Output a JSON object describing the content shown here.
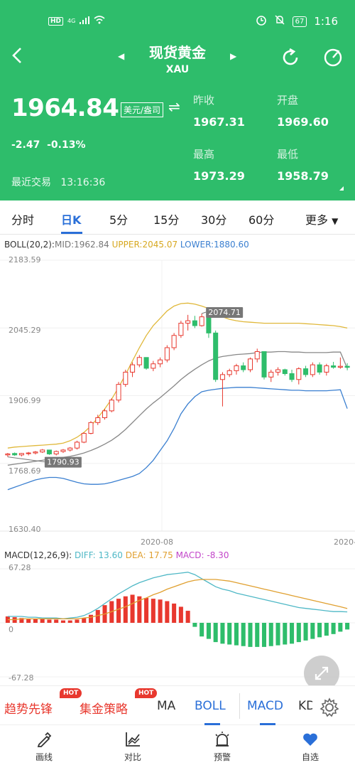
{
  "status_bar": {
    "network": "HD",
    "signal": "4G",
    "battery": "67",
    "time": "1:16"
  },
  "header": {
    "title": "现货黄金",
    "code": "XAU"
  },
  "quote": {
    "price": "1964.84",
    "unit": "美元/盎司",
    "change": "-2.47",
    "change_pct": "-0.13%",
    "last_trade_label": "最近交易",
    "last_trade_time": "13:16:36",
    "prev_close_label": "昨收",
    "prev_close": "1967.31",
    "open_label": "开盘",
    "open": "1969.60",
    "high_label": "最高",
    "high": "1973.29",
    "low_label": "最低",
    "low": "1958.79"
  },
  "period_tabs": [
    "分时",
    "日K",
    "5分",
    "15分",
    "30分",
    "60分",
    "更多"
  ],
  "active_period": "日K",
  "boll": {
    "label": "BOLL(20,2):",
    "mid": "MID:1962.84",
    "upper": "UPPER:2045.07",
    "lower": "LOWER:1880.60",
    "y_ticks": [
      "2183.59",
      "2045.29",
      "1906.99",
      "1768.69",
      "1630.40"
    ],
    "x_ticks": [
      "2020-08",
      "2020-"
    ],
    "max_marker": "2074.71",
    "min_marker": "1790.93"
  },
  "macd": {
    "label": "MACD(12,26,9):",
    "diff": "DIFF: 13.60",
    "dea": "DEA: 17.75",
    "macd": "MACD: -8.30",
    "y_ticks": [
      "67.28",
      "0",
      "-67.28"
    ]
  },
  "indicator_tabs": {
    "trend": "趋势先锋",
    "strategy": "集金策略",
    "hot": "HOT",
    "ma": "MA",
    "boll": "BOLL",
    "macd": "MACD",
    "kd": "KD"
  },
  "bottom_nav": [
    "画线",
    "对比",
    "预警",
    "自选"
  ],
  "colors": {
    "green": "#2ebd6b",
    "up": "#e8382e",
    "down": "#2ebd6b",
    "accent": "#2a6fd8",
    "mid": "#888888",
    "upper": "#e0b83a",
    "lower": "#3a7fd0",
    "diff": "#4fb8c6",
    "dea": "#e0a030",
    "macd": "#c244c9"
  },
  "chart_data": [
    {
      "type": "candlestick",
      "title": "BOLL(20,2)",
      "ylim": [
        1630.4,
        2183.59
      ],
      "y_ticks": [
        2183.59,
        2045.29,
        1906.99,
        1768.69,
        1630.4
      ],
      "series": [
        {
          "name": "K",
          "ohlc": [
            [
              1786,
              1790,
              1782,
              1788
            ],
            [
              1789,
              1791,
              1784,
              1786
            ],
            [
              1786,
              1790,
              1783,
              1789
            ],
            [
              1789,
              1792,
              1785,
              1790
            ],
            [
              1790,
              1794,
              1787,
              1792
            ],
            [
              1792,
              1798,
              1790,
              1796
            ],
            [
              1796,
              1794,
              1786,
              1788
            ],
            [
              1788,
              1795,
              1785,
              1793
            ],
            [
              1793,
              1798,
              1790,
              1796
            ],
            [
              1796,
              1802,
              1793,
              1800
            ],
            [
              1800,
              1815,
              1797,
              1812
            ],
            [
              1812,
              1832,
              1810,
              1830
            ],
            [
              1830,
              1855,
              1828,
              1852
            ],
            [
              1852,
              1868,
              1847,
              1862
            ],
            [
              1862,
              1880,
              1858,
              1876
            ],
            [
              1876,
              1902,
              1873,
              1898
            ],
            [
              1898,
              1935,
              1893,
              1930
            ],
            [
              1930,
              1960,
              1925,
              1955
            ],
            [
              1955,
              1975,
              1945,
              1970
            ],
            [
              1970,
              1990,
              1965,
              1985
            ],
            [
              1985,
              1980,
              1960,
              1963
            ],
            [
              1963,
              1978,
              1957,
              1972
            ],
            [
              1972,
              1985,
              1965,
              1980
            ],
            [
              1980,
              2010,
              1975,
              2005
            ],
            [
              2005,
              2035,
              2000,
              2030
            ],
            [
              2030,
              2060,
              2025,
              2055
            ],
            [
              2055,
              2072,
              2040,
              2060
            ],
            [
              2060,
              2070,
              2045,
              2050
            ],
            [
              2050,
              2074.71,
              2048,
              2068
            ],
            [
              2068,
              2065,
              2025,
              2035
            ],
            [
              2035,
              2040,
              1935,
              1940
            ],
            [
              1940,
              1955,
              1885,
              1950
            ],
            [
              1950,
              1962,
              1945,
              1958
            ],
            [
              1958,
              1972,
              1950,
              1968
            ],
            [
              1968,
              1975,
              1955,
              1960
            ],
            [
              1960,
              1985,
              1955,
              1982
            ],
            [
              1982,
              2003,
              1975,
              1997
            ],
            [
              1997,
              1990,
              1940,
              1945
            ],
            [
              1945,
              1960,
              1935,
              1955
            ],
            [
              1955,
              1965,
              1948,
              1960
            ],
            [
              1960,
              1962,
              1948,
              1952
            ],
            [
              1952,
              1960,
              1935,
              1940
            ],
            [
              1940,
              1965,
              1930,
              1962
            ],
            [
              1962,
              1968,
              1945,
              1950
            ],
            [
              1950,
              1975,
              1945,
              1970
            ],
            [
              1970,
              1975,
              1950,
              1955
            ],
            [
              1955,
              1972,
              1948,
              1968
            ],
            [
              1968,
              1976,
              1962,
              1965
            ],
            [
              1965,
              1985,
              1962,
              1967
            ],
            [
              1967,
              1973.29,
              1958.79,
              1964.84
            ]
          ]
        },
        {
          "name": "MID",
          "values": [
            1765,
            1767,
            1769,
            1771,
            1773,
            1775,
            1777,
            1779,
            1781,
            1783,
            1786,
            1790,
            1795,
            1801,
            1808,
            1816,
            1826,
            1838,
            1852,
            1866,
            1880,
            1892,
            1903,
            1915,
            1927,
            1940,
            1951,
            1961,
            1970,
            1978,
            1984,
            1987,
            1989,
            1991,
            1992,
            1993,
            1995,
            1996,
            1996,
            1997,
            1997,
            1996,
            1996,
            1995,
            1995,
            1995,
            1995,
            1996,
            1996,
            1962.84
          ]
        },
        {
          "name": "UPPER",
          "values": [
            1800,
            1802,
            1803,
            1804,
            1805,
            1806,
            1807,
            1808,
            1810,
            1815,
            1822,
            1832,
            1845,
            1862,
            1880,
            1900,
            1924,
            1950,
            1978,
            2005,
            2030,
            2050,
            2065,
            2080,
            2090,
            2095,
            2096,
            2094,
            2090,
            2085,
            2075,
            2068,
            2063,
            2060,
            2058,
            2057,
            2056,
            2055,
            2055,
            2055,
            2055,
            2055,
            2055,
            2054,
            2053,
            2052,
            2051,
            2050,
            2048,
            2045.07
          ]
        },
        {
          "name": "LOWER",
          "values": [
            1715,
            1720,
            1725,
            1730,
            1735,
            1738,
            1740,
            1740,
            1738,
            1734,
            1730,
            1727,
            1726,
            1726,
            1727,
            1730,
            1734,
            1738,
            1742,
            1748,
            1760,
            1775,
            1795,
            1815,
            1840,
            1870,
            1890,
            1905,
            1915,
            1918,
            1920,
            1922,
            1923,
            1924,
            1924,
            1924,
            1923,
            1922,
            1921,
            1920,
            1919,
            1918,
            1918,
            1917,
            1917,
            1917,
            1917,
            1918,
            1919,
            1880.6
          ]
        }
      ]
    },
    {
      "type": "bar",
      "title": "MACD(12,26,9)",
      "ylim": [
        -67.28,
        67.28
      ],
      "y_ticks": [
        67.28,
        0,
        -67.28
      ],
      "series": [
        {
          "name": "MACD",
          "values": [
            8,
            7,
            6,
            5,
            5,
            5,
            4,
            4,
            3,
            3,
            4,
            6,
            10,
            16,
            22,
            27,
            30,
            33,
            35,
            33,
            31,
            30,
            29,
            27,
            24,
            20,
            15,
            -5,
            -17,
            -20,
            -24,
            -26,
            -27,
            -28,
            -29,
            -30,
            -30,
            -30,
            -29,
            -28,
            -27,
            -26,
            -24,
            -22,
            -20,
            -18,
            -16,
            -14,
            -11,
            -8.3
          ]
        },
        {
          "name": "DIFF",
          "values": [
            8,
            8,
            8,
            7,
            7,
            6,
            6,
            6,
            5,
            6,
            7,
            9,
            13,
            18,
            24,
            30,
            36,
            41,
            46,
            50,
            53,
            56,
            58,
            60,
            61,
            62,
            63,
            60,
            55,
            50,
            45,
            42,
            40,
            37,
            35,
            33,
            31,
            29,
            27,
            25,
            23,
            21,
            19,
            18,
            17,
            16,
            15,
            14,
            14,
            13.6
          ]
        },
        {
          "name": "DEA",
          "values": [
            4,
            4,
            5,
            5,
            5,
            5,
            5,
            5,
            5,
            5,
            5,
            6,
            7,
            9,
            11,
            14,
            17,
            20,
            24,
            28,
            31,
            35,
            38,
            42,
            45,
            48,
            51,
            53,
            54,
            54,
            54,
            53,
            52,
            50,
            48,
            46,
            44,
            42,
            40,
            38,
            36,
            34,
            32,
            30,
            28,
            26,
            24,
            22,
            20,
            17.75
          ]
        }
      ]
    }
  ]
}
